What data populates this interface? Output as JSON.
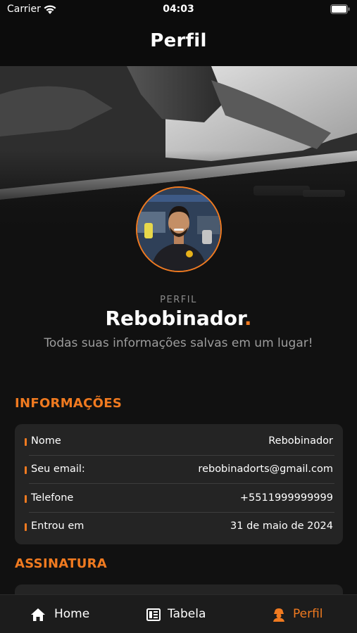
{
  "status_bar": {
    "carrier": "Carrier",
    "time": "04:03"
  },
  "nav": {
    "title": "Perfil"
  },
  "profile": {
    "eyebrow": "PERFIL",
    "name": "Rebobinador",
    "name_dot": ".",
    "subtitle": "Todas suas informações salvas em um lugar!"
  },
  "info_section": {
    "title": "INFORMAÇÕES",
    "rows": [
      {
        "label": "Nome",
        "value": "Rebobinador"
      },
      {
        "label": "Seu email:",
        "value": "rebobinadorts@gmail.com"
      },
      {
        "label": "Telefone",
        "value": "+5511999999999"
      },
      {
        "label": "Entrou em",
        "value": "31 de maio de 2024"
      }
    ]
  },
  "subscription_section": {
    "title": "ASSINATURA"
  },
  "tab_bar": {
    "items": [
      {
        "label": "Home",
        "icon": "home-icon"
      },
      {
        "label": "Tabela",
        "icon": "table-icon"
      },
      {
        "label": "Perfil",
        "icon": "worker-icon"
      }
    ],
    "active": "Perfil"
  },
  "colors": {
    "accent": "#f07a20",
    "background": "#111111",
    "card": "#242424"
  }
}
